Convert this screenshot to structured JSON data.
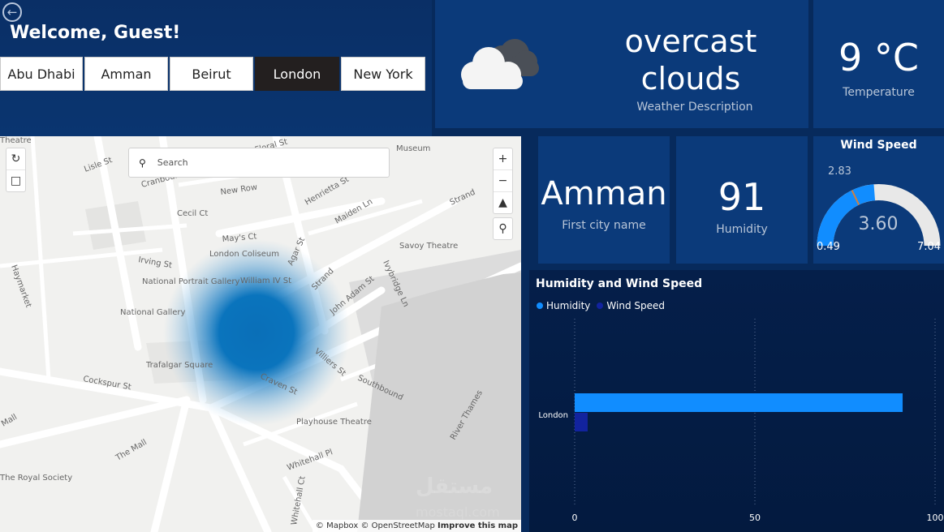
{
  "header": {
    "welcome": "Welcome, Guest!",
    "cities": [
      "Abu Dhabi",
      "Amman",
      "Beirut",
      "London",
      "New York"
    ],
    "selected_city": "London"
  },
  "weather": {
    "description_line1": "overcast",
    "description_line2": "clouds",
    "description_label": "Weather Description",
    "icon": "cloud-icon"
  },
  "temperature": {
    "value": "9 °C",
    "label": "Temperature"
  },
  "city": {
    "value": "Amman",
    "label": "First city name"
  },
  "humidity": {
    "value": "91",
    "label": "Humidity"
  },
  "wind": {
    "title": "Wind Speed",
    "value": "3.60",
    "min": "0.49",
    "max": "7.04",
    "target": "2.83"
  },
  "map": {
    "search_placeholder": "Search",
    "attribution_1": "© Mapbox © OpenStreetMap",
    "attribution_2": "Improve this map",
    "streets": [
      "Lisle St",
      "Cranbourn St",
      "Cecil Ct",
      "New Row",
      "Floral St",
      "Henrietta St",
      "Maiden Ln",
      "Strand",
      "Savoy Theatre",
      "May's Ct",
      "London Coliseum",
      "Irving St",
      "National Portrait Gallery",
      "William IV St",
      "Agar St",
      "Strand",
      "John Adam St",
      "Ivybridge Ln",
      "National Gallery",
      "Trafalgar Square",
      "Villiers St",
      "Southbound",
      "Cockspur St",
      "Craven St",
      "Playhouse Theatre",
      "The Mall",
      "River Thames",
      "Whitehall Pl",
      "Whitehall Ct",
      "The Royal Society",
      "Haymarket",
      "Mall",
      "Museum",
      "Theatre"
    ]
  },
  "chart": {
    "title": "Humidity and Wind Speed",
    "legend": [
      "Humidity",
      "Wind Speed"
    ],
    "colors": [
      "#118dff",
      "#12239e"
    ],
    "x_ticks": [
      "0",
      "50",
      "100"
    ]
  },
  "chart_data": {
    "type": "bar",
    "orientation": "horizontal",
    "title": "Humidity and Wind Speed",
    "categories": [
      "London"
    ],
    "series": [
      {
        "name": "Humidity",
        "values": [
          91
        ]
      },
      {
        "name": "Wind Speed",
        "values": [
          3.6
        ]
      }
    ],
    "xlim": [
      0,
      100
    ],
    "grid": "vertical dotted",
    "legend_position": "top-left"
  },
  "watermark": {
    "line1": "مستقل",
    "line2": "mostaql.com"
  }
}
